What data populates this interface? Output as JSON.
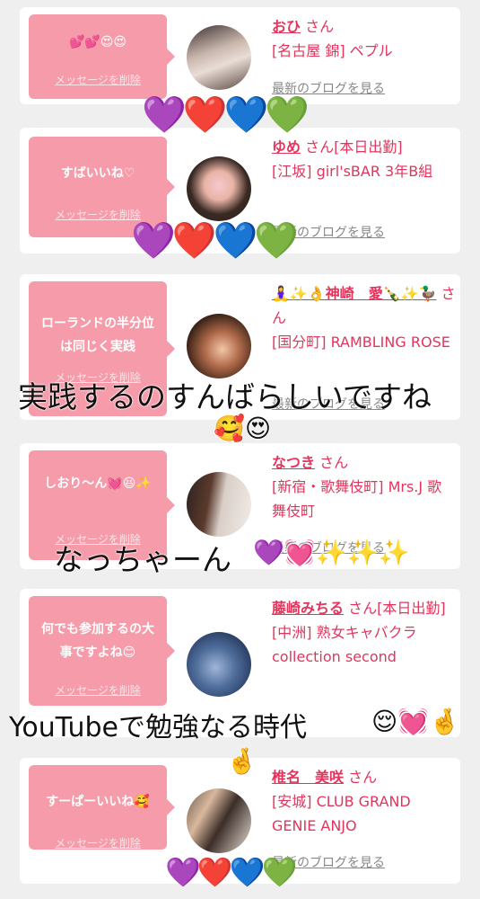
{
  "cards": [
    {
      "message": "💕💕😍😍",
      "delete_label": "メッセージを削除",
      "name": "おひ",
      "san": "さん",
      "area": "[名古屋 錦] ペプル",
      "blog_label": "最新のブログを見る"
    },
    {
      "message": "すばいいね♡",
      "delete_label": "メッセージを削除",
      "name": "ゆめ",
      "san": "さん[本日出勤]",
      "area": "[江坂] girl'sBAR 3年B組",
      "blog_label": "最新のブログを見る"
    },
    {
      "message": "ローランドの半分位は同じく実践",
      "delete_label": "メッセージを削除",
      "name": "🧘‍♀️✨👌神崎　愛🍾✨🦆",
      "san": "さん",
      "area": "[国分町] RAMBLING ROSE",
      "blog_label": "最新のブログを見る"
    },
    {
      "message": "しおり〜ん💓😆✨",
      "delete_label": "メッセージを削除",
      "name": "なつき",
      "san": "さん",
      "area": "[新宿・歌舞伎町] Mrs.J 歌舞伎町",
      "blog_label": "最新のブログを見る"
    },
    {
      "message": "何でも参加するの大事ですよね😊",
      "delete_label": "メッセージを削除",
      "name": "藤崎みちる",
      "san": "さん[本日出勤]",
      "area": "[中洲] 熟女キャバクラ collection second",
      "blog_label": "最新のブログを見る"
    },
    {
      "message": "すーぱーいいね🥰",
      "delete_label": "メッセージを削除",
      "name": "椎名　美咲",
      "san": "さん",
      "area": "[安城] CLUB GRAND GENIE ANJO",
      "blog_label": "最新のブログを見る"
    }
  ],
  "overlays": {
    "hearts": "💜❤️💙💚",
    "text1": "実践するのすんばらしいですね",
    "text1_emoji": "🥰😍",
    "text2": "なっちゃーん",
    "text2_emoji": "💜💓✨✨✨",
    "text3": "YouTubeで勉強なる時代",
    "text3_emoji": "😌💓🤞",
    "text3_emoji_line2": "🤞"
  },
  "colors": {
    "bubble": "#f59ba9",
    "accent": "#e2355d",
    "background": "#efefef"
  }
}
